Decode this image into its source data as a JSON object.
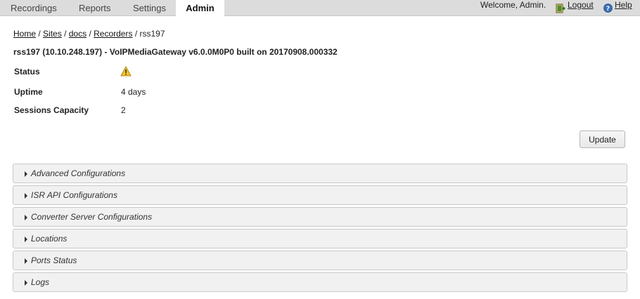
{
  "nav": {
    "tabs": [
      {
        "label": "Recordings"
      },
      {
        "label": "Reports"
      },
      {
        "label": "Settings"
      },
      {
        "label": "Admin",
        "active": true
      }
    ],
    "welcome": "Welcome, Admin.",
    "logout": "Logout",
    "help": "Help"
  },
  "breadcrumb": {
    "items": [
      "Home",
      "Sites",
      "docs",
      "Recorders"
    ],
    "current": "rss197",
    "separator": "/"
  },
  "server": {
    "title": "rss197 (10.10.248.197) - VoIPMediaGateway v6.0.0M0P0 built on 20170908.000332"
  },
  "info": {
    "status_label": "Status",
    "status_icon": "warning-icon",
    "uptime_label": "Uptime",
    "uptime_value": "4 days",
    "capacity_label": "Sessions Capacity",
    "capacity_value": "2"
  },
  "update_button": "Update",
  "sections": [
    "Advanced Configurations",
    "ISR API Configurations",
    "Converter Server Configurations",
    "Locations",
    "Ports Status",
    "Logs"
  ],
  "colors": {
    "topbar": "#dcdcdc",
    "section_bg": "#f1f1f1",
    "warning": "#f2c230"
  }
}
